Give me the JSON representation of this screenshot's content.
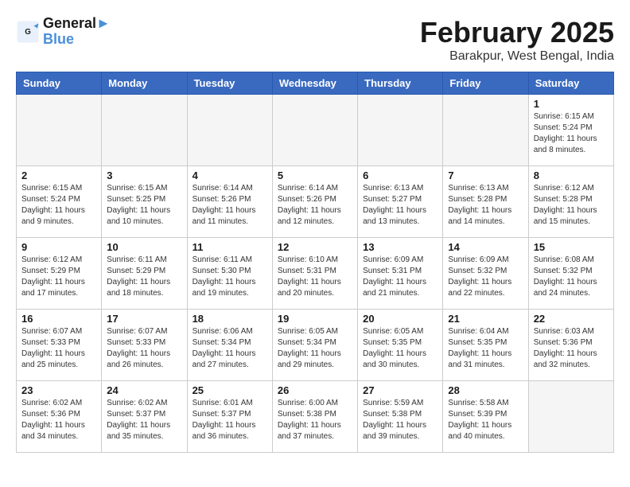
{
  "logo": {
    "line1": "General",
    "line2": "Blue"
  },
  "title": "February 2025",
  "location": "Barakpur, West Bengal, India",
  "weekdays": [
    "Sunday",
    "Monday",
    "Tuesday",
    "Wednesday",
    "Thursday",
    "Friday",
    "Saturday"
  ],
  "weeks": [
    [
      {
        "day": "",
        "info": ""
      },
      {
        "day": "",
        "info": ""
      },
      {
        "day": "",
        "info": ""
      },
      {
        "day": "",
        "info": ""
      },
      {
        "day": "",
        "info": ""
      },
      {
        "day": "",
        "info": ""
      },
      {
        "day": "1",
        "info": "Sunrise: 6:15 AM\nSunset: 5:24 PM\nDaylight: 11 hours and 8 minutes."
      }
    ],
    [
      {
        "day": "2",
        "info": "Sunrise: 6:15 AM\nSunset: 5:24 PM\nDaylight: 11 hours and 9 minutes."
      },
      {
        "day": "3",
        "info": "Sunrise: 6:15 AM\nSunset: 5:25 PM\nDaylight: 11 hours and 10 minutes."
      },
      {
        "day": "4",
        "info": "Sunrise: 6:14 AM\nSunset: 5:26 PM\nDaylight: 11 hours and 11 minutes."
      },
      {
        "day": "5",
        "info": "Sunrise: 6:14 AM\nSunset: 5:26 PM\nDaylight: 11 hours and 12 minutes."
      },
      {
        "day": "6",
        "info": "Sunrise: 6:13 AM\nSunset: 5:27 PM\nDaylight: 11 hours and 13 minutes."
      },
      {
        "day": "7",
        "info": "Sunrise: 6:13 AM\nSunset: 5:28 PM\nDaylight: 11 hours and 14 minutes."
      },
      {
        "day": "8",
        "info": "Sunrise: 6:12 AM\nSunset: 5:28 PM\nDaylight: 11 hours and 15 minutes."
      }
    ],
    [
      {
        "day": "9",
        "info": "Sunrise: 6:12 AM\nSunset: 5:29 PM\nDaylight: 11 hours and 17 minutes."
      },
      {
        "day": "10",
        "info": "Sunrise: 6:11 AM\nSunset: 5:29 PM\nDaylight: 11 hours and 18 minutes."
      },
      {
        "day": "11",
        "info": "Sunrise: 6:11 AM\nSunset: 5:30 PM\nDaylight: 11 hours and 19 minutes."
      },
      {
        "day": "12",
        "info": "Sunrise: 6:10 AM\nSunset: 5:31 PM\nDaylight: 11 hours and 20 minutes."
      },
      {
        "day": "13",
        "info": "Sunrise: 6:09 AM\nSunset: 5:31 PM\nDaylight: 11 hours and 21 minutes."
      },
      {
        "day": "14",
        "info": "Sunrise: 6:09 AM\nSunset: 5:32 PM\nDaylight: 11 hours and 22 minutes."
      },
      {
        "day": "15",
        "info": "Sunrise: 6:08 AM\nSunset: 5:32 PM\nDaylight: 11 hours and 24 minutes."
      }
    ],
    [
      {
        "day": "16",
        "info": "Sunrise: 6:07 AM\nSunset: 5:33 PM\nDaylight: 11 hours and 25 minutes."
      },
      {
        "day": "17",
        "info": "Sunrise: 6:07 AM\nSunset: 5:33 PM\nDaylight: 11 hours and 26 minutes."
      },
      {
        "day": "18",
        "info": "Sunrise: 6:06 AM\nSunset: 5:34 PM\nDaylight: 11 hours and 27 minutes."
      },
      {
        "day": "19",
        "info": "Sunrise: 6:05 AM\nSunset: 5:34 PM\nDaylight: 11 hours and 29 minutes."
      },
      {
        "day": "20",
        "info": "Sunrise: 6:05 AM\nSunset: 5:35 PM\nDaylight: 11 hours and 30 minutes."
      },
      {
        "day": "21",
        "info": "Sunrise: 6:04 AM\nSunset: 5:35 PM\nDaylight: 11 hours and 31 minutes."
      },
      {
        "day": "22",
        "info": "Sunrise: 6:03 AM\nSunset: 5:36 PM\nDaylight: 11 hours and 32 minutes."
      }
    ],
    [
      {
        "day": "23",
        "info": "Sunrise: 6:02 AM\nSunset: 5:36 PM\nDaylight: 11 hours and 34 minutes."
      },
      {
        "day": "24",
        "info": "Sunrise: 6:02 AM\nSunset: 5:37 PM\nDaylight: 11 hours and 35 minutes."
      },
      {
        "day": "25",
        "info": "Sunrise: 6:01 AM\nSunset: 5:37 PM\nDaylight: 11 hours and 36 minutes."
      },
      {
        "day": "26",
        "info": "Sunrise: 6:00 AM\nSunset: 5:38 PM\nDaylight: 11 hours and 37 minutes."
      },
      {
        "day": "27",
        "info": "Sunrise: 5:59 AM\nSunset: 5:38 PM\nDaylight: 11 hours and 39 minutes."
      },
      {
        "day": "28",
        "info": "Sunrise: 5:58 AM\nSunset: 5:39 PM\nDaylight: 11 hours and 40 minutes."
      },
      {
        "day": "",
        "info": ""
      }
    ]
  ]
}
